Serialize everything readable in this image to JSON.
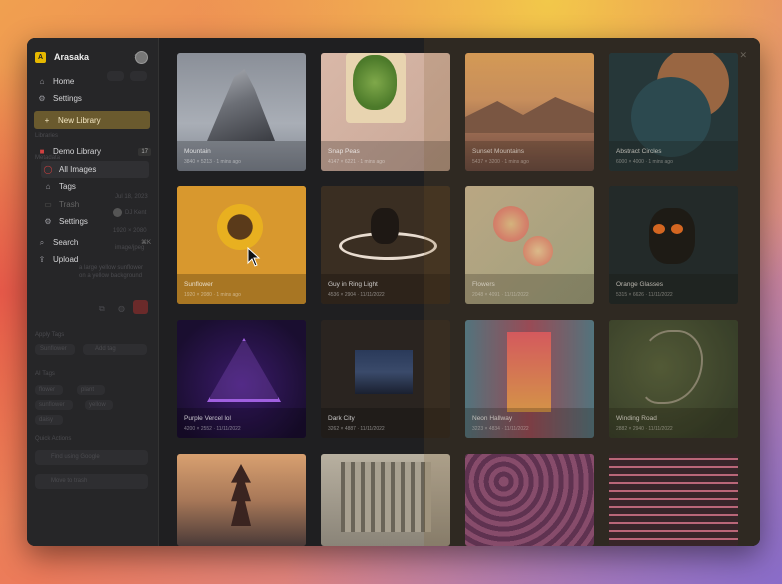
{
  "app": {
    "workspace": "Arasaka"
  },
  "colors": {
    "accent": "#e6b800",
    "highlight": "#6a5a2e",
    "delete": "#c0392b"
  },
  "sidebar": {
    "items": [
      {
        "label": "Home",
        "icon": "home-icon"
      },
      {
        "label": "Settings",
        "icon": "gear-icon"
      },
      {
        "label": "New Library",
        "icon": "plus-icon"
      }
    ],
    "section_libraries": "Libraries",
    "library": {
      "name": "Demo Library",
      "count": "17"
    },
    "library_items": [
      {
        "label": "All Images",
        "icon": "images-icon"
      },
      {
        "label": "Tags",
        "icon": "tag-icon"
      },
      {
        "label": "Trash",
        "icon": "trash-icon"
      },
      {
        "label": "Settings",
        "icon": "gear-icon"
      },
      {
        "label": "Search",
        "icon": "search-icon",
        "shortcut": "⌘K"
      },
      {
        "label": "Upload",
        "icon": "upload-icon"
      }
    ]
  },
  "inspector_ghost": {
    "metadata": "Metadata",
    "date": "Jul 18, 2023",
    "author": "DJ Kent",
    "dims": "1920 × 2080",
    "type": "image/jpeg",
    "desc": "a large yellow sunflower on a yellow background",
    "apply_tags": "Apply Tags",
    "tag_input": "Sunflower",
    "add_tag": "Add tag",
    "ai_tags_label": "AI Tags",
    "ai_tags": [
      "flower",
      "plant",
      "sunflower",
      "yellow",
      "daisy"
    ],
    "quick_actions": "Quick Actions",
    "find_google": "Find using Google",
    "move_trash": "Move to trash"
  },
  "grid": [
    {
      "title": "Mountain",
      "meta": "3840 × 5213 · 1 mins ago"
    },
    {
      "title": "Snap Peas",
      "meta": "4147 × 6221 · 1 mins ago"
    },
    {
      "title": "Sunset Mountains",
      "meta": "5437 × 3200 · 1 mins ago"
    },
    {
      "title": "Abstract Circles",
      "meta": "6000 × 4000 · 1 mins ago"
    },
    {
      "title": "Sunflower",
      "meta": "1920 × 2080 · 1 mins ago"
    },
    {
      "title": "Guy in Ring Light",
      "meta": "4536 × 2904 · 11/11/2022"
    },
    {
      "title": "Flowers",
      "meta": "2048 × 4091 · 11/11/2022"
    },
    {
      "title": "Orange Glasses",
      "meta": "5315 × 6626 · 11/11/2022"
    },
    {
      "title": "Purple Vercel lol",
      "meta": "4200 × 2552 · 11/11/2022"
    },
    {
      "title": "Dark City",
      "meta": "3262 × 4887 · 11/11/2022"
    },
    {
      "title": "Neon Hallway",
      "meta": "3223 × 4834 · 11/11/2022"
    },
    {
      "title": "Winding Road",
      "meta": "2882 × 2940 · 11/11/2022"
    },
    {
      "title": "",
      "meta": ""
    },
    {
      "title": "",
      "meta": ""
    },
    {
      "title": "",
      "meta": ""
    },
    {
      "title": "",
      "meta": ""
    }
  ]
}
